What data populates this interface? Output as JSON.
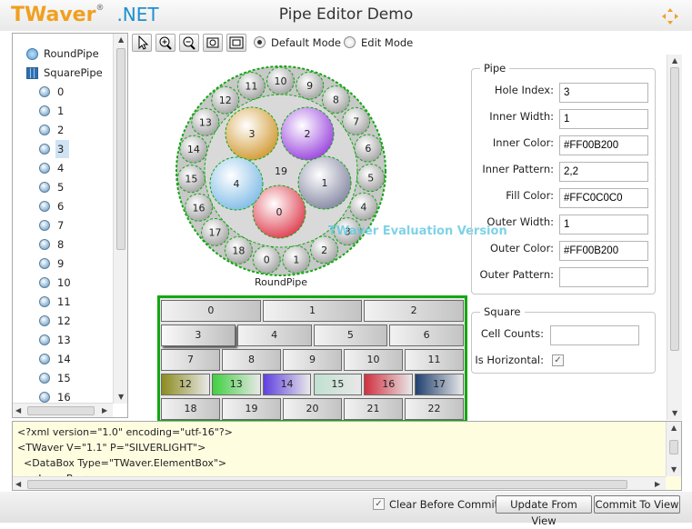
{
  "header": {
    "logo_main": "TWaver",
    "logo_reg": "®",
    "logo_suffix": ".NET",
    "title": "Pipe Editor Demo"
  },
  "tree": {
    "roots": [
      {
        "label": "RoundPipe",
        "icon": "round-pipe-icon"
      },
      {
        "label": "SquarePipe",
        "icon": "square-pipe-icon"
      }
    ],
    "children": [
      "0",
      "1",
      "2",
      "3",
      "4",
      "5",
      "6",
      "7",
      "8",
      "9",
      "10",
      "11",
      "12",
      "13",
      "14",
      "15",
      "16"
    ],
    "selected": "3"
  },
  "toolbar": {
    "tools": [
      "select-arrow-icon",
      "zoom-in-icon",
      "zoom-out-icon",
      "zoom-fit-icon",
      "zoom-reset-icon"
    ],
    "modes": [
      {
        "label": "Default Mode",
        "checked": true
      },
      {
        "label": "Edit Mode",
        "checked": false
      }
    ]
  },
  "canvas": {
    "round_pipe_label": "RoundPipe",
    "center_label": "19",
    "inner_holes": [
      {
        "label": "0",
        "color": "#E04A5A"
      },
      {
        "label": "1",
        "color": "#8C8FA8"
      },
      {
        "label": "2",
        "color": "#A050E0"
      },
      {
        "label": "3",
        "color": "#D4A040"
      },
      {
        "label": "4",
        "color": "#88C0E8"
      }
    ],
    "outer_holes": [
      "0",
      "1",
      "2",
      "3",
      "4",
      "5",
      "6",
      "7",
      "8",
      "9",
      "10",
      "11",
      "12",
      "13",
      "14",
      "15",
      "16",
      "17",
      "18"
    ],
    "watermark": "TWaver Evaluation Version",
    "square_cells": [
      [
        "0",
        "1",
        "2"
      ],
      [
        "3",
        "4",
        "5",
        "6"
      ],
      [
        "7",
        "8",
        "9",
        "10",
        "11"
      ],
      [
        "12",
        "13",
        "14",
        "15",
        "16",
        "17"
      ],
      [
        "18",
        "19",
        "20",
        "21",
        "22"
      ]
    ],
    "square_colors": {
      "12": "#8C8C20",
      "13": "#40D040",
      "14": "#6040E0",
      "15": "#C0E0D0",
      "16": "#D03040",
      "17": "#204070"
    }
  },
  "pipe_panel": {
    "legend": "Pipe",
    "fields": [
      {
        "label": "Hole Index:",
        "value": "3"
      },
      {
        "label": "Inner Width:",
        "value": "1"
      },
      {
        "label": "Inner Color:",
        "value": "#FF00B200"
      },
      {
        "label": "Inner Pattern:",
        "value": "2,2"
      },
      {
        "label": "Fill Color:",
        "value": "#FFC0C0C0"
      },
      {
        "label": "Outer Width:",
        "value": "1"
      },
      {
        "label": "Outer Color:",
        "value": "#FF00B200"
      },
      {
        "label": "Outer Pattern:",
        "value": ""
      }
    ]
  },
  "square_panel": {
    "legend": "Square",
    "cell_counts_label": "Cell Counts:",
    "cell_counts_value": "",
    "horizontal_label": "Is Horizontal:",
    "horizontal_checked": true
  },
  "xml": {
    "lines": [
      "<?xml version=\"1.0\" encoding=\"utf-16\"?>",
      "<TWaver V=\"1.1\" P=\"SILVERLIGHT\">",
      "  <DataBox Type=\"TWaver.ElementBox\">",
      "    <LayerBox>"
    ]
  },
  "footer": {
    "clear_label": "Clear Before Commit",
    "clear_checked": true,
    "update_label": "Update From View",
    "commit_label": "Commit To View"
  },
  "colors": {
    "pipe_green": "#13A713",
    "fill": "#C0C0C0",
    "accent": "#1E8FD0",
    "logo_orange": "#F0A020"
  }
}
